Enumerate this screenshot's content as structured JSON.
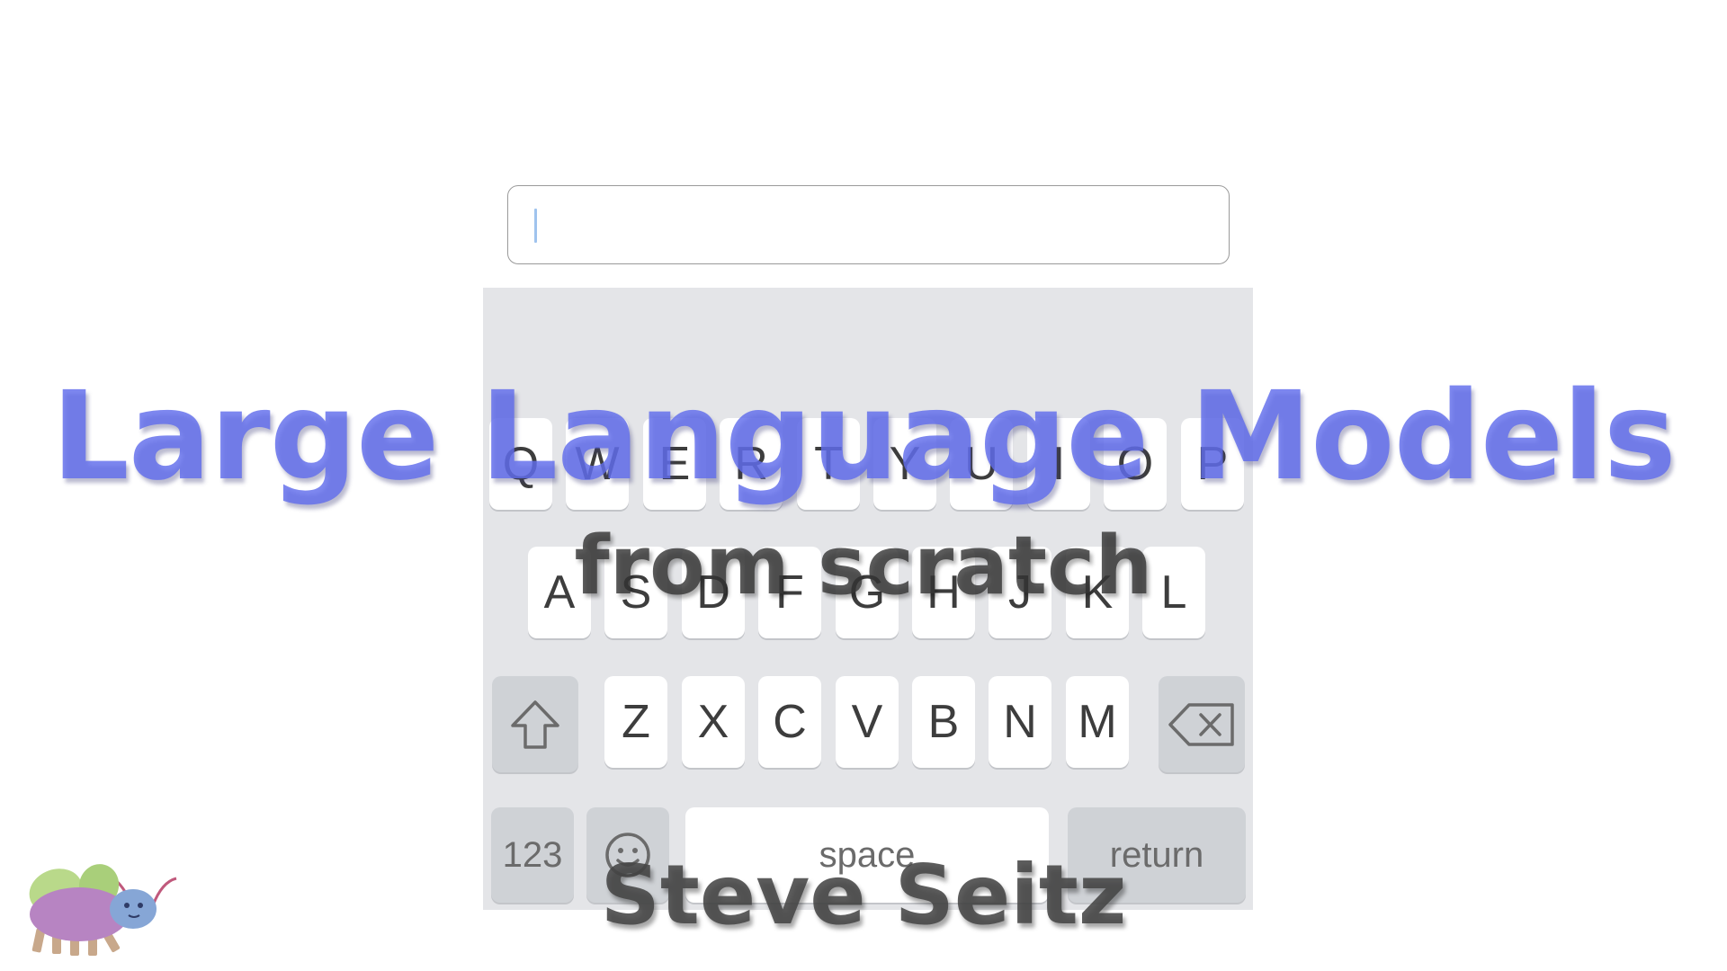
{
  "input": {
    "value": ""
  },
  "keyboard": {
    "row1": [
      "Q",
      "W",
      "E",
      "R",
      "T",
      "Y",
      "U",
      "I",
      "O",
      "P"
    ],
    "row2": [
      "A",
      "S",
      "D",
      "F",
      "G",
      "H",
      "J",
      "K",
      "L"
    ],
    "row3": [
      "Z",
      "X",
      "C",
      "V",
      "B",
      "N",
      "M"
    ],
    "shift_icon": "shift-arrow-icon",
    "backspace_icon": "backspace-icon",
    "numbers_label": "123",
    "emoji_icon": "smiley-icon",
    "space_label": "space",
    "return_label": "return"
  },
  "overlay": {
    "title": "Large Language Models",
    "subtitle": "from scratch",
    "author": "Steve Seitz"
  },
  "mascot": {
    "icon": "bug-mascot-icon"
  },
  "colors": {
    "title": "#606cea",
    "keyboard_bg": "#e4e5e8",
    "key_bg": "#ffffff",
    "special_key_bg": "#cfd2d6",
    "caret": "#9fc3ee"
  }
}
